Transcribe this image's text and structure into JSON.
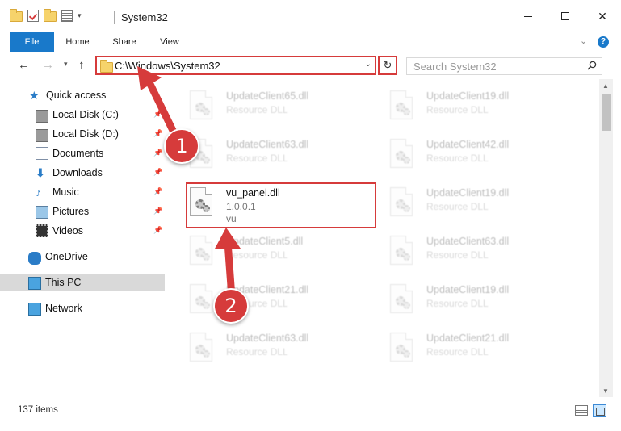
{
  "window": {
    "title": "System32",
    "controls": {
      "minimize": "—",
      "maximize": "☐",
      "close": "✕"
    }
  },
  "ribbon": {
    "tabs": [
      "File",
      "Home",
      "Share",
      "View"
    ],
    "expand_chevron": "⌄",
    "help": "?"
  },
  "address": {
    "back": "←",
    "forward": "→",
    "recent": "▾",
    "up": "↑",
    "path": "C:\\Windows\\System32",
    "dropdown": "⌄",
    "refresh": "↻"
  },
  "search": {
    "placeholder": "Search System32"
  },
  "nav": {
    "items": [
      {
        "label": "Quick access",
        "icon": "star-icon",
        "pinned": false
      },
      {
        "label": "Local Disk (C:)",
        "icon": "drive-icon",
        "pinned": true
      },
      {
        "label": "Local Disk (D:)",
        "icon": "drive-icon",
        "pinned": true
      },
      {
        "label": "Documents",
        "icon": "documents-icon",
        "pinned": true
      },
      {
        "label": "Downloads",
        "icon": "downloads-icon",
        "pinned": true
      },
      {
        "label": "Music",
        "icon": "music-icon",
        "pinned": true
      },
      {
        "label": "Pictures",
        "icon": "pictures-icon",
        "pinned": true
      },
      {
        "label": "Videos",
        "icon": "videos-icon",
        "pinned": true
      },
      {
        "label": "OneDrive",
        "icon": "onedrive-icon",
        "pinned": false
      },
      {
        "label": "This PC",
        "icon": "this-pc-icon",
        "pinned": false,
        "selected": true
      },
      {
        "label": "Network",
        "icon": "network-icon",
        "pinned": false
      }
    ],
    "pin_glyph": "📌"
  },
  "files": {
    "left": [
      {
        "name": "UpdateClient65.dll",
        "type": "Resource DLL"
      },
      {
        "name": "UpdateClient63.dll",
        "type": "Resource DLL"
      },
      {
        "name": "vu_panel.dll",
        "version": "1.0.0.1",
        "company": "vu"
      },
      {
        "name": "UpdateClient5.dll",
        "type": "Resource DLL"
      },
      {
        "name": "UpdateClient21.dll",
        "type": "Resource DLL"
      },
      {
        "name": "UpdateClient63.dll",
        "type": "Resource DLL"
      }
    ],
    "right": [
      {
        "name": "UpdateClient19.dll",
        "type": "Resource DLL"
      },
      {
        "name": "UpdateClient42.dll",
        "type": "Resource DLL"
      },
      {
        "name": "UpdateClient19.dll",
        "type": "Resource DLL"
      },
      {
        "name": "UpdateClient63.dll",
        "type": "Resource DLL"
      },
      {
        "name": "UpdateClient19.dll",
        "type": "Resource DLL"
      },
      {
        "name": "UpdateClient21.dll",
        "type": "Resource DLL"
      }
    ]
  },
  "status": {
    "item_count": "137 items"
  },
  "annotations": {
    "step1": "1",
    "step2": "2",
    "color": "#d63b3b"
  }
}
